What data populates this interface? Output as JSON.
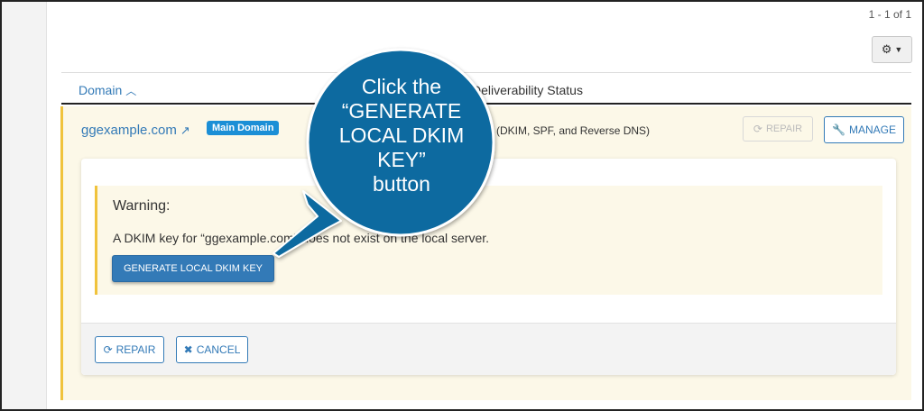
{
  "pagination": {
    "text": "1 - 1 of 1"
  },
  "toolbar": {
    "settings_icon": "gear-icon",
    "caret_icon": "caret-down-icon"
  },
  "table": {
    "header_domain": "Domain",
    "header_status": "Deliverability Status",
    "sort_icon": "chevron-up-icon"
  },
  "domain_row": {
    "domain": "ggexample.com",
    "link_icon": "external-link-icon",
    "badge": "Main Domain",
    "status": "(DKIM, SPF, and Reverse DNS)",
    "repair_label": "REPAIR",
    "manage_label": "MANAGE"
  },
  "panel": {
    "warning_title": "Warning:",
    "warning_message": "A DKIM key for “ggexample.com” does not exist on the local server.",
    "generate_label": "GENERATE LOCAL DKIM KEY",
    "repair_label": "REPAIR",
    "cancel_label": "CANCEL"
  },
  "callout": {
    "line1": "Click the",
    "line2": "“GENERATE",
    "line3": "LOCAL DKIM",
    "line4": "KEY”",
    "line5": "button"
  },
  "colors": {
    "link_blue": "#337ab7",
    "badge_blue": "#1b8fd6",
    "warning_bg": "#fcf8e8",
    "warning_border": "#f0c33c",
    "callout_blue": "#0b6aa0"
  }
}
